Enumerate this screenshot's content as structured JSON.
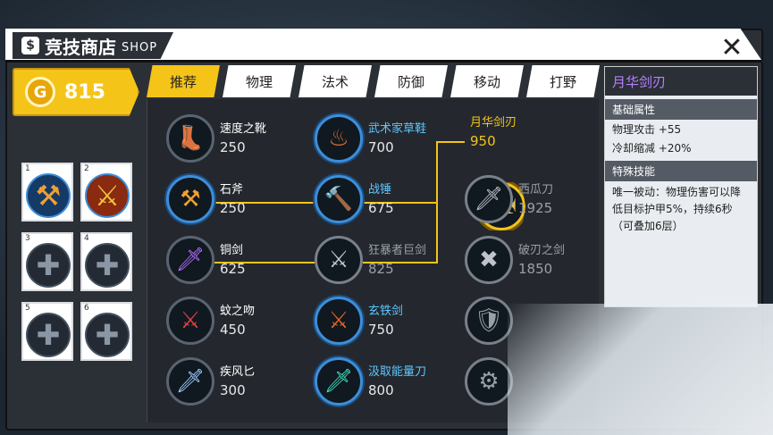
{
  "header": {
    "title": "竞技商店",
    "subtitle": "SHOP",
    "close_label": "✕"
  },
  "gold": {
    "amount": "815",
    "coin_glyph": "G"
  },
  "slots": [
    {
      "num": "1",
      "icon": "hammer-icon",
      "filled": true
    },
    {
      "num": "2",
      "icon": "sword-icon",
      "filled": true
    },
    {
      "num": "3",
      "icon": "plus-icon",
      "filled": false
    },
    {
      "num": "4",
      "icon": "plus-icon",
      "filled": false
    },
    {
      "num": "5",
      "icon": "plus-icon",
      "filled": false
    },
    {
      "num": "6",
      "icon": "plus-icon",
      "filled": false
    }
  ],
  "tabs": [
    "推荐",
    "物理",
    "法术",
    "防御",
    "移动",
    "打野"
  ],
  "items": {
    "col1": [
      {
        "name": "速度之靴",
        "price": "250"
      },
      {
        "name": "石斧",
        "price": "250"
      },
      {
        "name": "铜剑",
        "price": "625"
      },
      {
        "name": "蚊之吻",
        "price": "450"
      },
      {
        "name": "疾风匕",
        "price": "300"
      }
    ],
    "col2": [
      {
        "name": "武术家草鞋",
        "price": "700"
      },
      {
        "name": "战锤",
        "price": "675"
      },
      {
        "name": "狂暴者巨剑",
        "price": "825"
      },
      {
        "name": "玄铁剑",
        "price": "750"
      },
      {
        "name": "汲取能量刀",
        "price": "800"
      }
    ],
    "col3": [
      {
        "name": "月华剑刃",
        "price": "950"
      },
      {
        "name": "西瓜刀",
        "price": "1925"
      },
      {
        "name": "破刃之剑",
        "price": "1850"
      }
    ]
  },
  "detail": {
    "title": "月华剑刃",
    "base_header": "基础属性",
    "stat1": "物理攻击 +55",
    "stat2": "冷却缩减 +20%",
    "skill_header": "特殊技能",
    "skill_text": "唯一被动：物理伤害可以降低目标护甲5%，持续6秒（可叠加6层）"
  },
  "colors": {
    "accent": "#f4c419",
    "blue_name": "#5cc6ff",
    "purple_title": "#b680ff"
  }
}
